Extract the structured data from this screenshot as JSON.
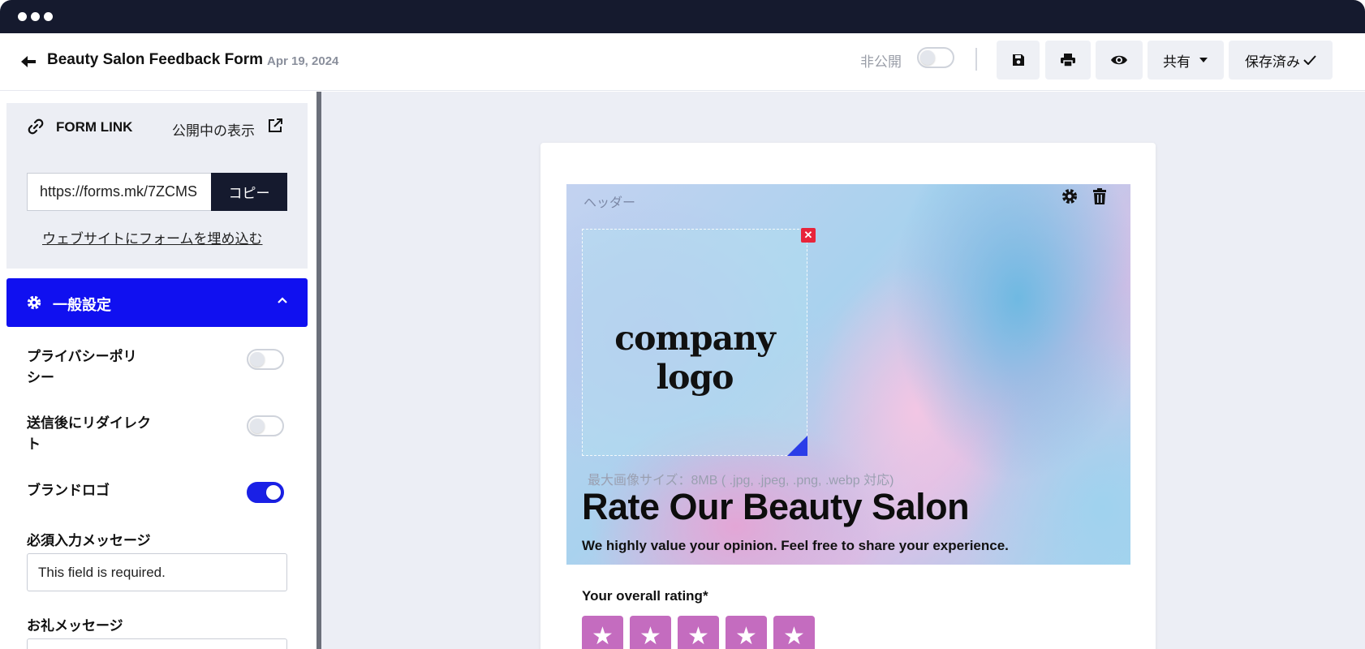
{
  "header": {
    "title": "Beauty Salon Feedback Form",
    "date": "Apr 19, 2024",
    "private_label": "非公開",
    "share_label": "共有",
    "saved_label": "保存済み"
  },
  "sidebar": {
    "form_link_title": "FORM LINK",
    "public_view_label": "公開中の表示",
    "url": "https://forms.mk/7ZCMS",
    "copy_label": "コピー",
    "embed_label": "ウェブサイトにフォームを埋め込む",
    "general_settings_label": "一般設定",
    "settings": [
      {
        "label": "プライバシーポリシー",
        "enabled": false
      },
      {
        "label": "送信後にリダイレクト",
        "enabled": false
      },
      {
        "label": "ブランドロゴ",
        "enabled": true
      }
    ],
    "required_message_label": "必須入力メッセージ",
    "required_message_value": "This field is required.",
    "thanks_message_label": "お礼メッセージ"
  },
  "form": {
    "header_label": "ヘッダー",
    "logo_text": "company logo",
    "image_hint": "最大画像サイズ：8MB ( .jpg, .jpeg, .png, .webp 対応)",
    "heading": "Rate Our Beauty Salon",
    "subheading": "We highly value your opinion. Feel free to share your experience.",
    "rating_label": "Your overall rating*",
    "rating_stars": 5
  },
  "colors": {
    "accent": "#1010f0",
    "dark": "#151a2e",
    "star": "#c46cbf"
  }
}
